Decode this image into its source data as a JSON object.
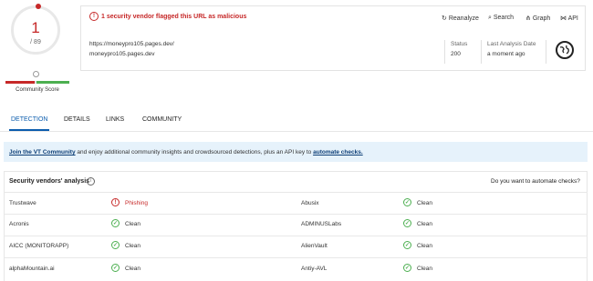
{
  "score": {
    "detections": "1",
    "total": "/ 89"
  },
  "community": {
    "label": "Community Score"
  },
  "summary": {
    "alert": "1 security vendor flagged this URL as malicious",
    "alert_icon": "!",
    "actions": [
      "Reanalyze",
      "Search",
      "Graph",
      "API"
    ],
    "url_line1": "https://moneypro105.pages.dev/",
    "url_line2": "moneypro105.pages.dev",
    "status_label": "Status",
    "status_value": "200",
    "date_label": "Last Analysis Date",
    "date_value": "a moment ago"
  },
  "tabs": [
    "DETECTION",
    "DETAILS",
    "LINKS",
    "COMMUNITY"
  ],
  "banner": {
    "link1": "Join the VT Community",
    "text": " and enjoy additional community insights and crowdsourced detections, plus an API key to ",
    "link2": "automate checks."
  },
  "vendors": {
    "title": "Security vendors' analysis",
    "automate_text": "Do you want to automate checks?",
    "rows": [
      {
        "left": {
          "vendor": "Trustwave",
          "result": "Phishing",
          "status": "malicious"
        },
        "right": {
          "vendor": "Abusix",
          "result": "Clean",
          "status": "clean"
        }
      },
      {
        "left": {
          "vendor": "Acronis",
          "result": "Clean",
          "status": "clean"
        },
        "right": {
          "vendor": "ADMINUSLabs",
          "result": "Clean",
          "status": "clean"
        }
      },
      {
        "left": {
          "vendor": "AICC (MONITORAPP)",
          "result": "Clean",
          "status": "clean"
        },
        "right": {
          "vendor": "AlienVault",
          "result": "Clean",
          "status": "clean"
        }
      },
      {
        "left": {
          "vendor": "alphaMountain.ai",
          "result": "Clean",
          "status": "clean"
        },
        "right": {
          "vendor": "Antiy-AVL",
          "result": "Clean",
          "status": "clean"
        }
      }
    ]
  },
  "colors": {
    "malicious": "#c62828",
    "clean": "#4caf50",
    "accent": "#0b5cad",
    "banner_bg": "#e6f2fb"
  }
}
